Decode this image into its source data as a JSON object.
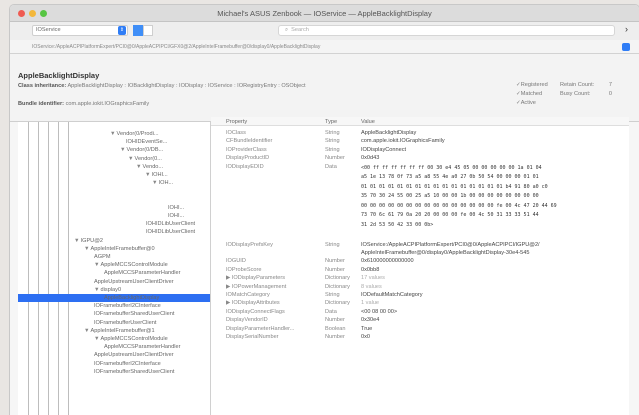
{
  "window": {
    "title": "Michael's ASUS Zenbook — IOService — AppleBacklightDisplay"
  },
  "toolbar": {
    "plane": "IOService",
    "search_placeholder": "Search"
  },
  "path": "IOService:/AppleACPIPlatformExpert/PCI0@0/AppleACPIPCI/GFX0@2/AppleIntelFramebuffer@0/display0/AppleBacklightDisplay",
  "info": {
    "class_name": "AppleBacklightDisplay",
    "inheritance_label": "Class inheritance:",
    "inheritance": "AppleBacklightDisplay : IOBacklightDisplay : IODisplay : IOService : IORegistryEntry : OSObject",
    "bundle_label": "Bundle identifier:",
    "bundle": "com.apple.iokit.IOGraphicsFamily",
    "flags": [
      "Registered",
      "Matched",
      "Active"
    ],
    "counts": [
      {
        "label": "Retain Count:",
        "value": "7"
      },
      {
        "label": "Busy Count:",
        "value": "0"
      }
    ]
  },
  "tree": [
    {
      "text": "Vendor(0/Prodi...",
      "indent": 92,
      "tri": "▼"
    },
    {
      "text": "IOHIDEventSe...",
      "indent": 108,
      "tri": ""
    },
    {
      "text": "Vendor(0/DB...",
      "indent": 102,
      "tri": "▼"
    },
    {
      "text": "Vendor(0...",
      "indent": 110,
      "tri": "▼"
    },
    {
      "text": "Vendo...",
      "indent": 118,
      "tri": "▼"
    },
    {
      "text": "IOHI...",
      "indent": 127,
      "tri": "▼"
    },
    {
      "text": "IOH...",
      "indent": 134,
      "tri": "▼"
    },
    {
      "text": "",
      "indent": 0,
      "tri": ""
    },
    {
      "text": "",
      "indent": 0,
      "tri": ""
    },
    {
      "text": "IOHI...",
      "indent": 150,
      "tri": ""
    },
    {
      "text": "IOHI...",
      "indent": 150,
      "tri": ""
    },
    {
      "text": "IOHIDLibUserClient",
      "indent": 128,
      "tri": ""
    },
    {
      "text": "IOHIDLibUserClient",
      "indent": 128,
      "tri": ""
    },
    {
      "text": "IGPU@2",
      "indent": 56,
      "tri": "▼"
    },
    {
      "text": "AppleIntelFramebuffer@0",
      "indent": 66,
      "tri": "▼"
    },
    {
      "text": "AGPM",
      "indent": 76,
      "tri": ""
    },
    {
      "text": "AppleMCCSControlModule",
      "indent": 76,
      "tri": "▼"
    },
    {
      "text": "AppleMCCSParameterHandler",
      "indent": 86,
      "tri": ""
    },
    {
      "text": "AppleUpstreamUserClientDriver",
      "indent": 76,
      "tri": ""
    },
    {
      "text": "display0",
      "indent": 76,
      "tri": "▼"
    },
    {
      "text": "AppleBacklightDisplay",
      "indent": 86,
      "tri": "",
      "selected": true
    },
    {
      "text": "IOFramebufferI2CInterface",
      "indent": 76,
      "tri": ""
    },
    {
      "text": "IOFramebufferSharedUserClient",
      "indent": 76,
      "tri": ""
    },
    {
      "text": "IOFramebufferUserClient",
      "indent": 76,
      "tri": ""
    },
    {
      "text": "AppleIntelFramebuffer@1",
      "indent": 66,
      "tri": "▼"
    },
    {
      "text": "AppleMCCSControlModule",
      "indent": 76,
      "tri": "▼"
    },
    {
      "text": "AppleMCCSParameterHandler",
      "indent": 86,
      "tri": ""
    },
    {
      "text": "AppleUpstreamUserClientDriver",
      "indent": 76,
      "tri": ""
    },
    {
      "text": "IOFramebufferI2CInterface",
      "indent": 76,
      "tri": ""
    },
    {
      "text": "IOFramebufferSharedUserClient",
      "indent": 76,
      "tri": ""
    }
  ],
  "props": {
    "headers": [
      "Property",
      "Type",
      "Value"
    ],
    "rows_top": [
      {
        "name": "IOClass",
        "type": "String",
        "value": "AppleBacklightDisplay"
      },
      {
        "name": "CFBundleIdentifier",
        "type": "String",
        "value": "com.apple.iokit.IOGraphicsFamily"
      },
      {
        "name": "IOProviderClass",
        "type": "String",
        "value": "IODisplayConnect"
      },
      {
        "name": "DisplayProductID",
        "type": "Number",
        "value": "0x0d43"
      },
      {
        "name": "IODisplayEDID",
        "type": "Data",
        "value": ""
      }
    ],
    "edid_lines": [
      "<00 ff ff ff ff ff ff 00 30 e4 45 05 00 00 00 00 00 1a 01 04",
      "a5 1e 13 78 0f 73 a5 a8 55 4e a0 27 0b 50 54 00 00 00 01 01",
      "01 01 01 01 01 01 01 01 01 01 01 01 01 01 01 01 b4 91 80 a0 c0",
      "35 70 30 24 55 00 25 a5 10 00 00 1b 00 00 00 00 00 00 00 00",
      "00 00 00 00 00 00 00 00 00 00 00 00 00 00 00 fe 00 4c 47 20 44 69",
      "73 70 6c 61 79 0a 20 20 00 00 00 fe 00 4c 50 31 33 33 51 44",
      "31 2d 53 50 42 33 00 0b>"
    ],
    "rows_bottom": [
      {
        "name": "IODisplayPrefsKey",
        "type": "String",
        "value": "IOService:/AppleACPIPlatformExpert/PCI0@0/AppleACPIPCI/IGPU@2/"
      },
      {
        "name": "",
        "type": "",
        "value": "AppleIntelFramebuffer@0/display0/AppleBacklightDisplay-30e4-545"
      },
      {
        "name": "IOGUID",
        "type": "Number",
        "value": "0x610000000000000"
      },
      {
        "name": "IOProbeScore",
        "type": "Number",
        "value": "0x0bb8"
      },
      {
        "name": "▶ IODisplayParameters",
        "type": "Dictionary",
        "value": "17 values",
        "fade": true
      },
      {
        "name": "▶ IOPowerManagement",
        "type": "Dictionary",
        "value": "8 values",
        "fade": true
      },
      {
        "name": "IOMatchCategory",
        "type": "String",
        "value": "IODefaultMatchCategory"
      },
      {
        "name": "▶ IODisplayAttributes",
        "type": "Dictionary",
        "value": "1 value",
        "fade": true
      },
      {
        "name": "IODisplayConnectFlags",
        "type": "Data",
        "value": "<00 08 00 00>"
      },
      {
        "name": "DisplayVendorID",
        "type": "Number",
        "value": "0x30e4"
      },
      {
        "name": "DisplayParameterHandler...",
        "type": "Boolean",
        "value": "True"
      },
      {
        "name": "DisplaySerialNumber",
        "type": "Number",
        "value": "0x0"
      }
    ]
  }
}
